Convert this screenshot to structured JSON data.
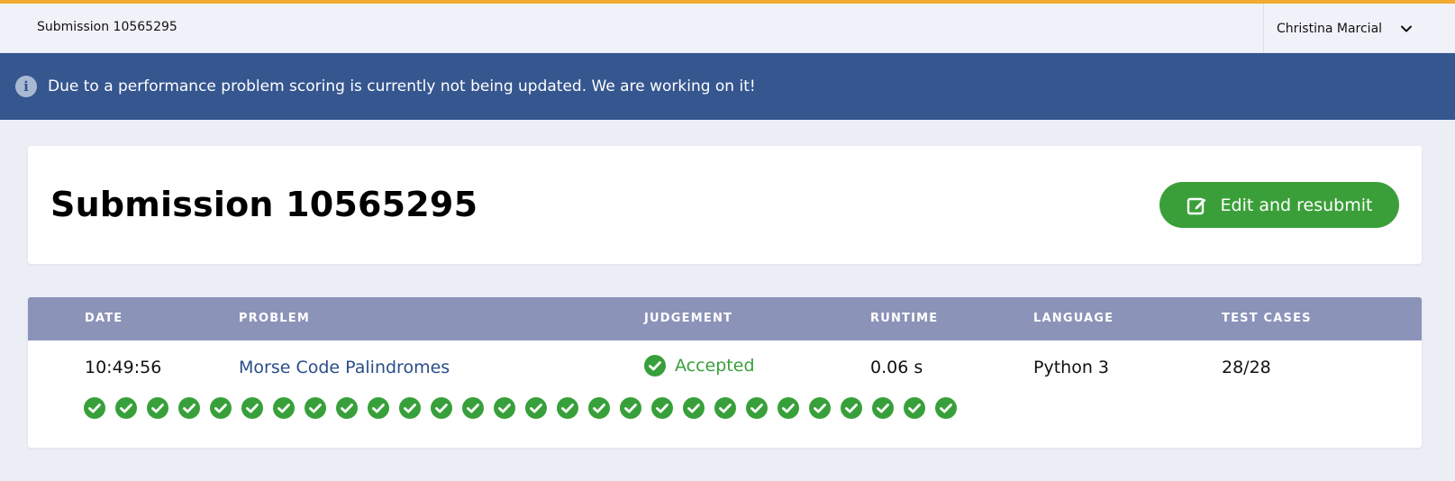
{
  "topbar": {
    "title": "Submission 10565295",
    "user_name": "Christina Marcial",
    "accent_color": "#f2ab2e"
  },
  "notice": {
    "icon": "info-icon",
    "text": "Due to a performance problem scoring is currently not being updated. We are working on it!",
    "background": "#35568f"
  },
  "header": {
    "title": "Submission 10565295",
    "resubmit_label": "Edit and resubmit",
    "resubmit_icon": "edit-icon",
    "button_color": "#3b9f39"
  },
  "table": {
    "columns": [
      "DATE",
      "PROBLEM",
      "JUDGEMENT",
      "RUNTIME",
      "LANGUAGE",
      "TEST CASES"
    ],
    "row": {
      "date": "10:49:56",
      "problem": "Morse Code Palindromes",
      "judgement": "Accepted",
      "runtime": "0.06 s",
      "language": "Python 3",
      "test_cases": "28/28"
    },
    "header_color": "#8c93b9",
    "test_results": [
      "passed",
      "passed",
      "passed",
      "passed",
      "passed",
      "passed",
      "passed",
      "passed",
      "passed",
      "passed",
      "passed",
      "passed",
      "passed",
      "passed",
      "passed",
      "passed",
      "passed",
      "passed",
      "passed",
      "passed",
      "passed",
      "passed",
      "passed",
      "passed",
      "passed",
      "passed",
      "passed",
      "passed"
    ]
  }
}
